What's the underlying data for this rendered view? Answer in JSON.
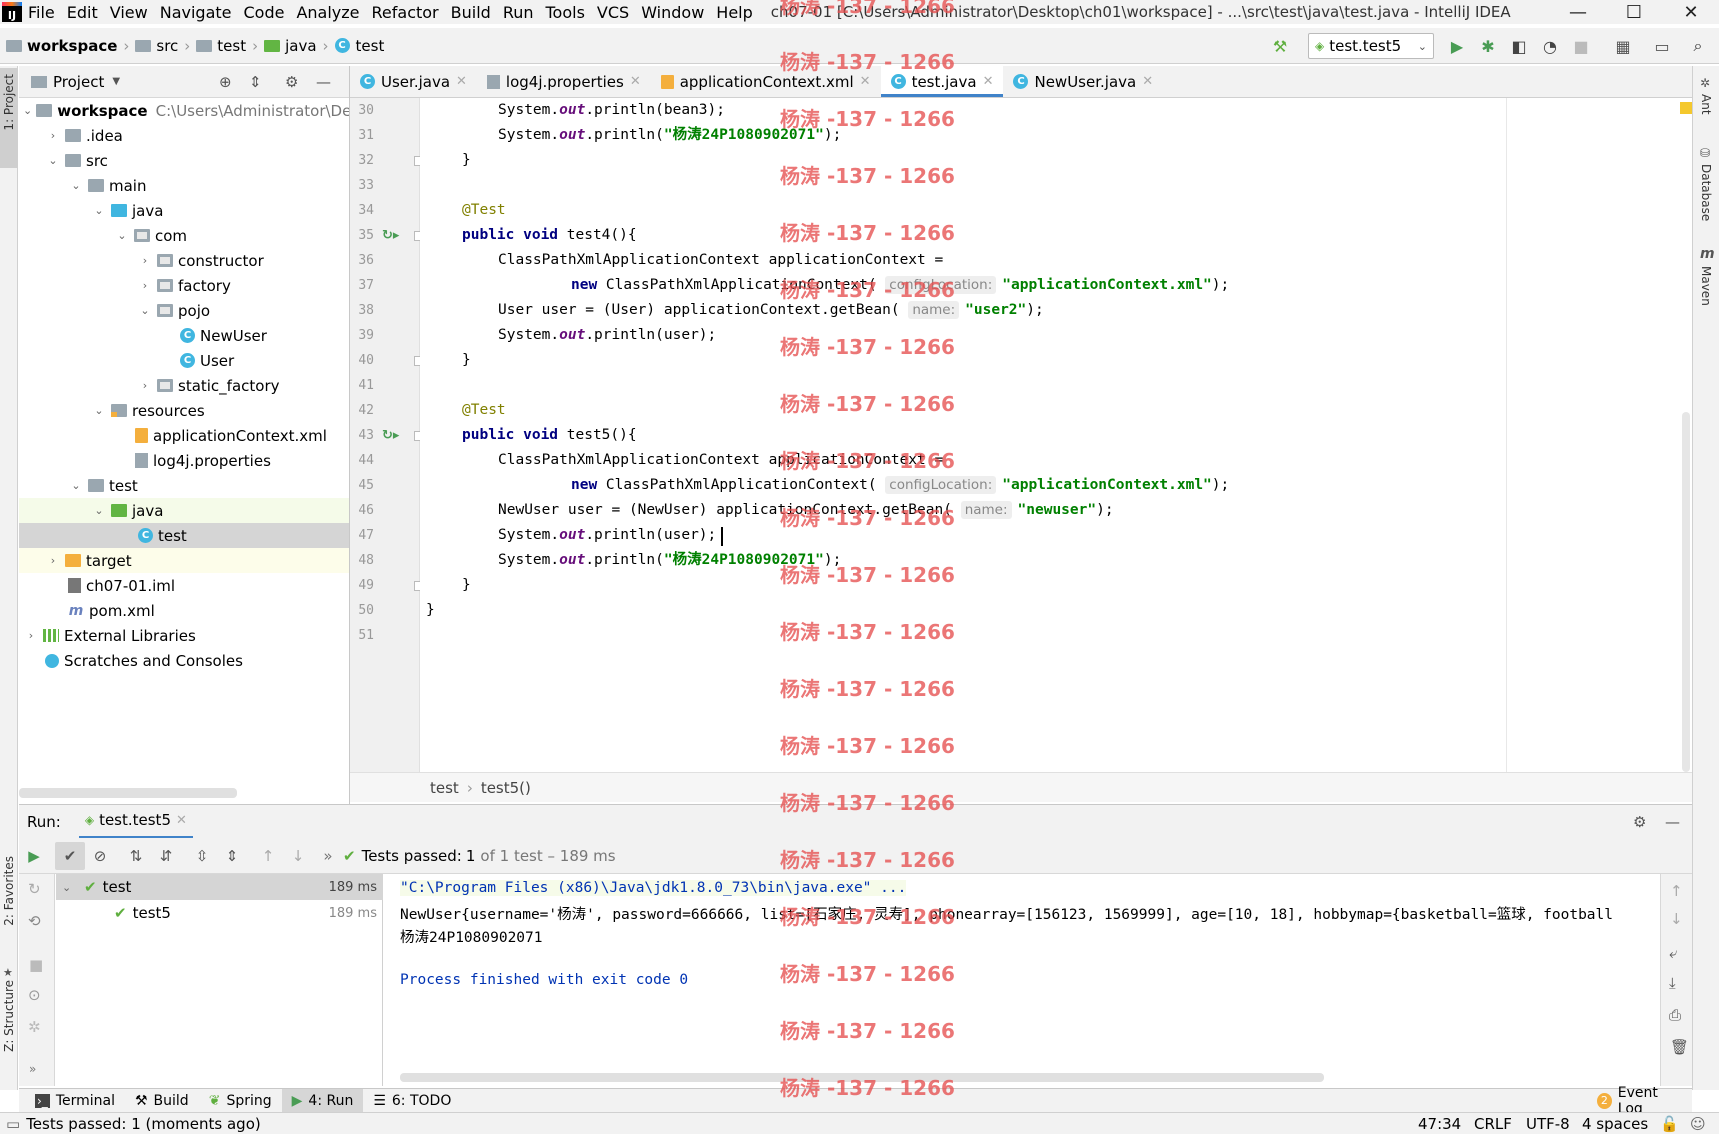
{
  "menubar": {
    "items": [
      "File",
      "Edit",
      "View",
      "Navigate",
      "Code",
      "Analyze",
      "Refactor",
      "Build",
      "Run",
      "Tools",
      "VCS",
      "Window",
      "Help"
    ],
    "mnemonics": [
      "F",
      "E",
      "V",
      "N",
      "C",
      "z",
      "R",
      "B",
      "u",
      "T",
      "S",
      "W",
      "H"
    ],
    "window_title": "ch07-01 [C:\\Users\\Administrator\\Desktop\\ch01\\workspace] - ...\\src\\test\\java\\test.java - IntelliJ IDEA"
  },
  "navbar": {
    "crumbs": [
      "workspace",
      "src",
      "test",
      "java",
      "test"
    ],
    "run_config": "test.test5"
  },
  "left_stripe": {
    "project_tab": "1: Project",
    "favorites_tab": "2: Favorites",
    "structure_tab": "Z: Structure"
  },
  "right_stripe": {
    "ant_tab": "Ant",
    "database_tab": "Database",
    "maven_tab": "Maven"
  },
  "project_panel": {
    "title": "Project",
    "tree": [
      {
        "label": "workspace",
        "path": "C:\\Users\\Administrator\\De",
        "icon": "folder",
        "bold": true
      },
      {
        "label": ".idea",
        "icon": "folder"
      },
      {
        "label": "src",
        "icon": "folder"
      },
      {
        "label": "main",
        "icon": "folder"
      },
      {
        "label": "java",
        "icon": "folder-blue"
      },
      {
        "label": "com",
        "icon": "package"
      },
      {
        "label": "constructor",
        "icon": "package"
      },
      {
        "label": "factory",
        "icon": "package"
      },
      {
        "label": "pojo",
        "icon": "package"
      },
      {
        "label": "NewUser",
        "icon": "class"
      },
      {
        "label": "User",
        "icon": "class"
      },
      {
        "label": "static_factory",
        "icon": "package"
      },
      {
        "label": "resources",
        "icon": "resources"
      },
      {
        "label": "applicationContext.xml",
        "icon": "xml"
      },
      {
        "label": "log4j.properties",
        "icon": "properties"
      },
      {
        "label": "test",
        "icon": "folder"
      },
      {
        "label": "java",
        "icon": "folder-green"
      },
      {
        "label": "test",
        "icon": "test-class"
      },
      {
        "label": "target",
        "icon": "folder-orange"
      },
      {
        "label": "ch07-01.iml",
        "icon": "iml"
      },
      {
        "label": "pom.xml",
        "icon": "maven"
      },
      {
        "label": "External Libraries",
        "icon": "libraries"
      },
      {
        "label": "Scratches and Consoles",
        "icon": "scratches"
      }
    ]
  },
  "editor_tabs": [
    {
      "label": "User.java",
      "icon": "class"
    },
    {
      "label": "log4j.properties",
      "icon": "properties"
    },
    {
      "label": "applicationContext.xml",
      "icon": "xml"
    },
    {
      "label": "test.java",
      "icon": "test-class",
      "active": true
    },
    {
      "label": "NewUser.java",
      "icon": "class"
    }
  ],
  "editor": {
    "line_numbers": [
      "30",
      "31",
      "32",
      "33",
      "34",
      "35",
      "36",
      "37",
      "38",
      "39",
      "40",
      "41",
      "42",
      "43",
      "44",
      "45",
      "46",
      "47",
      "48",
      "49",
      "50",
      "51"
    ],
    "code": {
      "l30": "System.",
      "l30_field": "out",
      "l30_rest": ".println(bean3);",
      "l31": "System.",
      "l31_field": "out",
      "l31_mid": ".println(",
      "l31_str": "\"杨涛24P1080902071\"",
      "l31_end": ");",
      "l32": "}",
      "l34": "@Test",
      "l35_kw": "public void",
      "l35_rest": " test4(){",
      "l36": "ClassPathXmlApplicationContext applicationContext =",
      "l37_kw": "new",
      "l37_rest": " ClassPathXmlApplicationContext(",
      "l37_hint": "configLocation:",
      "l37_str": "\"applicationContext.xml\"",
      "l37_end": ");",
      "l38": "User user = (User) applicationContext.getBean(",
      "l38_hint": "name:",
      "l38_str": "\"user2\"",
      "l38_end": ");",
      "l39": "System.",
      "l39_field": "out",
      "l39_rest": ".println(user);",
      "l40": "}",
      "l42": "@Test",
      "l43_kw": "public void",
      "l43_rest": " test5(){",
      "l44": "ClassPathXmlApplicationContext applicationContext =",
      "l45_kw": "new",
      "l45_rest": " ClassPathXmlApplicationContext(",
      "l45_hint": "configLocation:",
      "l45_str": "\"applicationContext.xml\"",
      "l45_end": ");",
      "l46": "NewUser user = (NewUser) applicationContext.getBean(",
      "l46_hint": "name:",
      "l46_str": "\"newuser\"",
      "l46_end": ");",
      "l47": "System.",
      "l47_field": "out",
      "l47_rest": ".println(user);",
      "l48": "System.",
      "l48_field": "out",
      "l48_mid": ".println(",
      "l48_str": "\"杨涛24P1080902071\"",
      "l48_end": ");",
      "l49": "}",
      "l50": "}"
    },
    "breadcrumbs": [
      "test",
      "test5()"
    ]
  },
  "run_panel": {
    "label": "Run:",
    "tab": "test.test5",
    "status_prefix": "Tests passed:",
    "status_count": "1",
    "status_suffix": "of 1 test – 189 ms",
    "tree": [
      {
        "label": "test",
        "time": "189 ms"
      },
      {
        "label": "test5",
        "time": "189 ms"
      }
    ],
    "console": [
      "\"C:\\Program Files (x86)\\Java\\jdk1.8.0_73\\bin\\java.exe\" ...",
      "NewUser{username='杨涛', password=666666, list=[石家庄, 灵寿], phonearray=[156123, 1569999], age=[10, 18], hobbymap={basketball=篮球, football",
      "杨涛24P1080902071",
      "",
      "Process finished with exit code 0"
    ]
  },
  "toolwindows": [
    {
      "label": "Terminal",
      "icon": "terminal-icon"
    },
    {
      "label": "Build",
      "icon": "hammer-icon"
    },
    {
      "label": "Spring",
      "icon": "spring-icon"
    },
    {
      "label": "4: Run",
      "icon": "run-icon",
      "active": true
    },
    {
      "label": "6: TODO",
      "icon": "todo-icon"
    }
  ],
  "event_log": {
    "count": "2",
    "label": "Event Log"
  },
  "statusbar": {
    "message": "Tests passed: 1 (moments ago)",
    "position": "47:34",
    "line_sep": "CRLF",
    "encoding": "UTF-8",
    "indent": "4 spaces"
  },
  "watermark": "杨涛 -137 - 1266",
  "colors": {
    "accent": "#4083c9",
    "pass_green": "#5faf3f",
    "watermark": "#e65050"
  }
}
